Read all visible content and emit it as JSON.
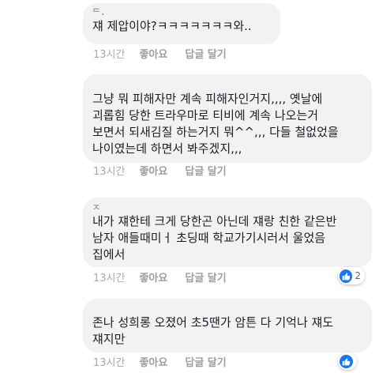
{
  "comments": [
    {
      "author": "ᄃ.",
      "lines": [
        "쟤 제압이야?ㅋㅋㅋㅋㅋㅋㅋ와.."
      ],
      "time": "13시간",
      "like": "좋아요",
      "reply": "답글 달기"
    },
    {
      "author": "",
      "lines": [
        "그냥 뭐 피해자만 계속 피해자인거지,,,, 옛날에",
        "괴롭힘 당한 트라우마로 티비에 계속 나오는거",
        "보면서 되새김질 하는거지 뭐^^,,, 다들 철없었을",
        "나이였는데 하면서 봐주겠지,,,"
      ],
      "time": "13시간",
      "like": "좋아요",
      "reply": "답글 달기"
    },
    {
      "author": "ㅈ",
      "lines": [
        "내가 쟤한테 크게 당한곤 아닌데 쟤랑 친한 같은반",
        "남자 애들때미ㅓ 초딩때 학교가기시러서 울었음",
        "집에서"
      ],
      "time": "13시간",
      "like": "좋아요",
      "reply": "답글 달기",
      "reactions": {
        "icon": "like-icon",
        "count": "2"
      }
    },
    {
      "author": "",
      "lines": [
        "존나 성희롱 오졌어 초5땐가 암튼 다 기억나 쟤도",
        "쟤지만"
      ],
      "time": "13시간",
      "like": "좋아요",
      "reply": "답글 달기",
      "reactions": {
        "icon": "like-icon"
      }
    }
  ],
  "colors": {
    "bubble": "#f1f2f4",
    "text": "#1c1e21",
    "meta": "#a6a9ae",
    "like_blue": "#1877f2"
  }
}
